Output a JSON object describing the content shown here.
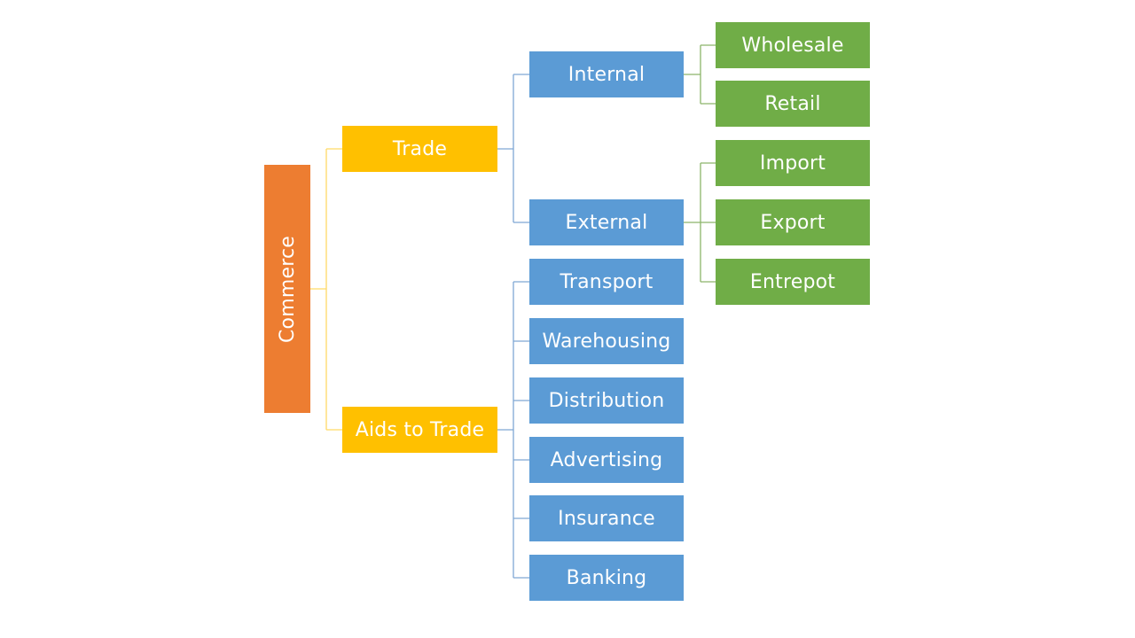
{
  "diagram": {
    "type": "hierarchy",
    "colors": {
      "root": "#ED7D31",
      "level1": "#FFC000",
      "level2": "#5B9BD5",
      "level3": "#70AD47",
      "line_level1": "#FFD966",
      "line_level2": "#7FA7D4",
      "line_level3": "#8CB56A"
    },
    "root": {
      "label": "Commerce",
      "children": [
        {
          "label": "Trade",
          "children": [
            {
              "label": "Internal",
              "children": [
                {
                  "label": "Wholesale"
                },
                {
                  "label": "Retail"
                }
              ]
            },
            {
              "label": "External",
              "children": [
                {
                  "label": "Import"
                },
                {
                  "label": "Export"
                },
                {
                  "label": "Entrepot"
                }
              ]
            }
          ]
        },
        {
          "label": "Aids to Trade",
          "children": [
            {
              "label": "Transport"
            },
            {
              "label": "Warehousing"
            },
            {
              "label": "Distribution"
            },
            {
              "label": "Advertising"
            },
            {
              "label": "Insurance"
            },
            {
              "label": "Banking"
            }
          ]
        }
      ]
    }
  }
}
